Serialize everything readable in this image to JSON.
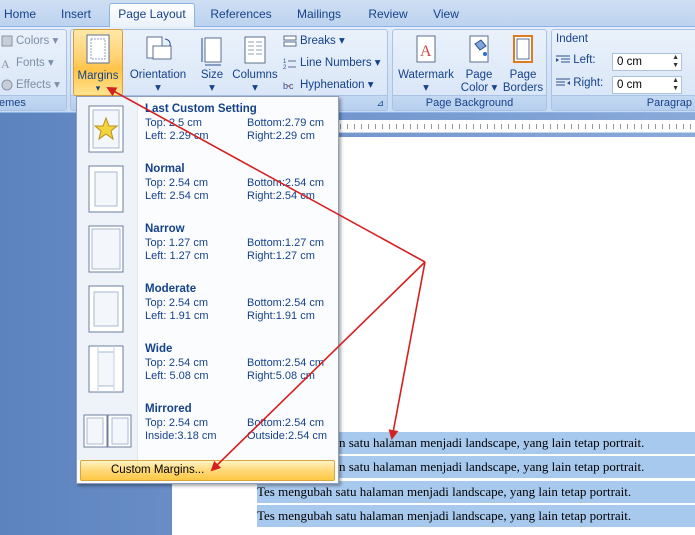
{
  "tabs": [
    "Home",
    "Insert",
    "Page Layout",
    "References",
    "Mailings",
    "Review",
    "View"
  ],
  "themes": {
    "colors": "Colors",
    "fonts": "Fonts",
    "effects": "Effects",
    "group": "emes"
  },
  "page_setup": {
    "margins": "Margins",
    "orientation": "Orientation",
    "size": "Size",
    "columns": "Columns",
    "breaks": "Breaks",
    "line_numbers": "Line Numbers",
    "hyphenation": "Hyphenation"
  },
  "page_background": {
    "watermark": "Watermark",
    "page_color_1": "Page",
    "page_color_2": "Color",
    "page_borders_1": "Page",
    "page_borders_2": "Borders",
    "group": "Page Background"
  },
  "paragraph": {
    "indent": "Indent",
    "left_label": "Left:",
    "right_label": "Right:",
    "left_value": "0 cm",
    "right_value": "0 cm",
    "group": "Paragrap"
  },
  "margin_presets": [
    {
      "name": "Last Custom Setting",
      "r1a": "Top:     2.5 cm",
      "r1b": "Bottom:2.79 cm",
      "r2a": "Left:    2.29 cm",
      "r2b": "Right:2.29 cm"
    },
    {
      "name": "Normal",
      "r1a": "Top:   2.54 cm",
      "r1b": "Bottom:2.54 cm",
      "r2a": "Left:   2.54 cm",
      "r2b": "Right:2.54 cm"
    },
    {
      "name": "Narrow",
      "r1a": "Top:   1.27 cm",
      "r1b": "Bottom:1.27 cm",
      "r2a": "Left:   1.27 cm",
      "r2b": "Right:1.27 cm"
    },
    {
      "name": "Moderate",
      "r1a": "Top:   2.54 cm",
      "r1b": "Bottom:2.54 cm",
      "r2a": "Left:   1.91 cm",
      "r2b": "Right:1.91 cm"
    },
    {
      "name": "Wide",
      "r1a": "Top:   2.54 cm",
      "r1b": "Bottom:2.54 cm",
      "r2a": "Left:   5.08 cm",
      "r2b": "Right:5.08 cm"
    },
    {
      "name": "Mirrored",
      "r1a": "Top:   2.54 cm",
      "r1b": "Bottom:2.54 cm",
      "r2a": "Inside:3.18 cm",
      "r2b": "Outside:2.54 cm"
    }
  ],
  "custom_margins": "Custom Margins...",
  "document_lines": [
    "n satu halaman menjadi landscape, yang lain tetap portrait.",
    "n satu halaman menjadi landscape, yang lain tetap portrait.",
    "Tes mengubah satu halaman menjadi landscape, yang lain tetap portrait.",
    "Tes mengubah satu halaman menjadi landscape, yang lain tetap portrait."
  ],
  "colors": {
    "arrow": "#d62020",
    "ribbon": "#d5e3f6",
    "selection": "#a8c9ee",
    "highlight": "#ffd06e"
  }
}
